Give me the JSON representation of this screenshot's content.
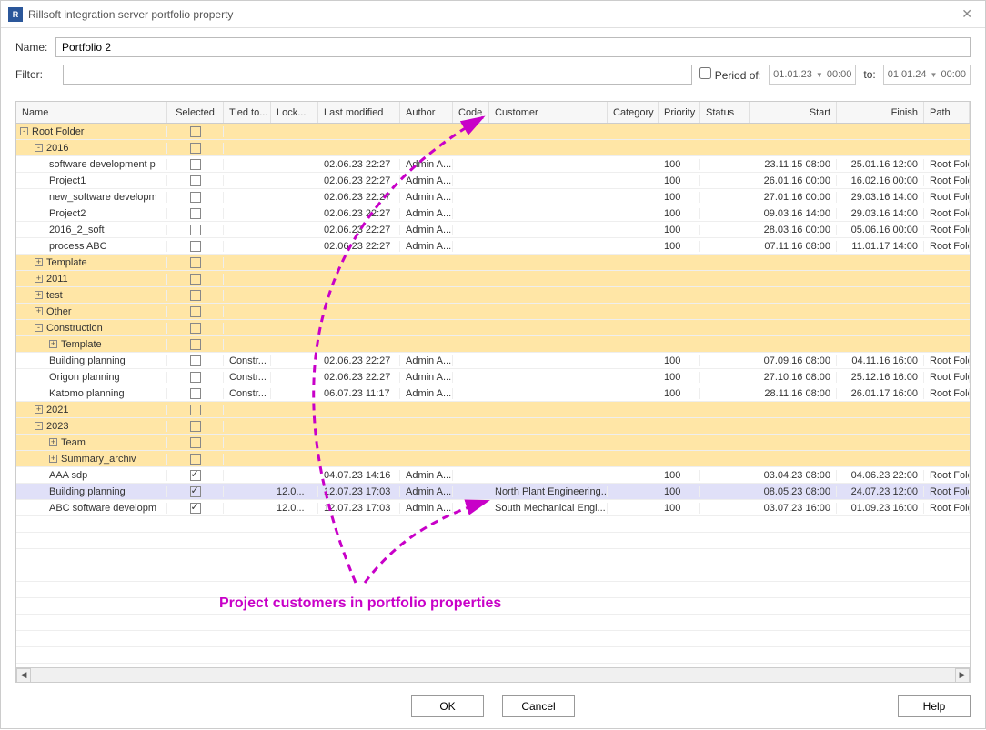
{
  "window": {
    "title": "Rillsoft integration server portfolio property",
    "icon": "R"
  },
  "form": {
    "name_label": "Name:",
    "name_value": "Portfolio 2",
    "filter_label": "Filter:",
    "period_label": "Period of:",
    "from_date": "01.01.23",
    "from_time": "00:00",
    "to_label": "to:",
    "to_date": "01.01.24",
    "to_time": "00:00"
  },
  "columns": {
    "name": "Name",
    "selected": "Selected",
    "tied": "Tied to...",
    "lock": "Lock...",
    "modified": "Last modified",
    "author": "Author",
    "code": "Code",
    "customer": "Customer",
    "category": "Category",
    "priority": "Priority",
    "status": "Status",
    "start": "Start",
    "finish": "Finish",
    "path": "Path"
  },
  "rows": [
    {
      "type": "folder",
      "depth": 0,
      "exp": "-",
      "name": "Root Folder",
      "sel": false
    },
    {
      "type": "folder",
      "depth": 1,
      "exp": "-",
      "name": "2016",
      "sel": false
    },
    {
      "type": "item",
      "depth": 2,
      "name": "software development p",
      "sel": false,
      "mod": "02.06.23 22:27",
      "auth": "Admin A...",
      "prio": "100",
      "start": "23.11.15 08:00",
      "fin": "25.01.16 12:00",
      "path": "Root Fold"
    },
    {
      "type": "item",
      "depth": 2,
      "name": "Project1",
      "sel": false,
      "mod": "02.06.23 22:27",
      "auth": "Admin A...",
      "prio": "100",
      "start": "26.01.16 00:00",
      "fin": "16.02.16 00:00",
      "path": "Root Fold"
    },
    {
      "type": "item",
      "depth": 2,
      "name": "new_software developm",
      "sel": false,
      "mod": "02.06.23 22:27",
      "auth": "Admin A...",
      "prio": "100",
      "start": "27.01.16 00:00",
      "fin": "29.03.16 14:00",
      "path": "Root Fold"
    },
    {
      "type": "item",
      "depth": 2,
      "name": "Project2",
      "sel": false,
      "mod": "02.06.23 22:27",
      "auth": "Admin A...",
      "prio": "100",
      "start": "09.03.16 14:00",
      "fin": "29.03.16 14:00",
      "path": "Root Fold"
    },
    {
      "type": "item",
      "depth": 2,
      "name": "2016_2_soft",
      "sel": false,
      "mod": "02.06.23 22:27",
      "auth": "Admin A...",
      "prio": "100",
      "start": "28.03.16 00:00",
      "fin": "05.06.16 00:00",
      "path": "Root Fold"
    },
    {
      "type": "item",
      "depth": 2,
      "name": "process ABC",
      "sel": false,
      "mod": "02.06.23 22:27",
      "auth": "Admin A...",
      "prio": "100",
      "start": "07.11.16 08:00",
      "fin": "11.01.17 14:00",
      "path": "Root Fold"
    },
    {
      "type": "folder",
      "depth": 1,
      "exp": "+",
      "name": "Template",
      "sel": false
    },
    {
      "type": "folder",
      "depth": 1,
      "exp": "+",
      "name": "2011",
      "sel": false
    },
    {
      "type": "folder",
      "depth": 1,
      "exp": "+",
      "name": "test",
      "sel": false
    },
    {
      "type": "folder",
      "depth": 1,
      "exp": "+",
      "name": "Other",
      "sel": false
    },
    {
      "type": "folder",
      "depth": 1,
      "exp": "-",
      "name": "Construction",
      "sel": false
    },
    {
      "type": "folder",
      "depth": 2,
      "exp": "+",
      "name": "Template",
      "sel": false
    },
    {
      "type": "item",
      "depth": 2,
      "name": "Building planning",
      "sel": false,
      "tied": "Constr...",
      "mod": "02.06.23 22:27",
      "auth": "Admin A...",
      "prio": "100",
      "start": "07.09.16 08:00",
      "fin": "04.11.16 16:00",
      "path": "Root Fold"
    },
    {
      "type": "item",
      "depth": 2,
      "name": "Origon planning",
      "sel": false,
      "tied": "Constr...",
      "mod": "02.06.23 22:27",
      "auth": "Admin A...",
      "prio": "100",
      "start": "27.10.16 08:00",
      "fin": "25.12.16 16:00",
      "path": "Root Fold"
    },
    {
      "type": "item",
      "depth": 2,
      "name": "Katomo planning",
      "sel": false,
      "tied": "Constr...",
      "mod": "06.07.23 11:17",
      "auth": "Admin A...",
      "prio": "100",
      "start": "28.11.16 08:00",
      "fin": "26.01.17 16:00",
      "path": "Root Fold"
    },
    {
      "type": "folder",
      "depth": 1,
      "exp": "+",
      "name": "2021",
      "sel": false
    },
    {
      "type": "folder",
      "depth": 1,
      "exp": "-",
      "name": "2023",
      "sel": false
    },
    {
      "type": "folder",
      "depth": 2,
      "exp": "+",
      "name": "Team",
      "sel": false
    },
    {
      "type": "folder",
      "depth": 2,
      "exp": "+",
      "name": "Summary_archiv",
      "sel": false
    },
    {
      "type": "item",
      "depth": 2,
      "name": "AAA sdp",
      "sel": true,
      "mod": "04.07.23 14:16",
      "auth": "Admin A...",
      "prio": "100",
      "start": "03.04.23 08:00",
      "fin": "04.06.23 22:00",
      "path": "Root Fold"
    },
    {
      "type": "item",
      "depth": 2,
      "name": "Building planning",
      "sel": true,
      "lock": "12.0...",
      "mod": "12.07.23 17:03",
      "auth": "Admin A...",
      "cust": "North Plant Engineering...",
      "prio": "100",
      "start": "08.05.23 08:00",
      "fin": "24.07.23 12:00",
      "path": "Root Fold",
      "highlight": true
    },
    {
      "type": "item",
      "depth": 2,
      "name": "ABC software developm",
      "sel": true,
      "lock": "12.0...",
      "mod": "12.07.23 17:03",
      "auth": "Admin A...",
      "cust": "South Mechanical Engi...",
      "prio": "100",
      "start": "03.07.23 16:00",
      "fin": "01.09.23 16:00",
      "path": "Root Fold"
    }
  ],
  "buttons": {
    "ok": "OK",
    "cancel": "Cancel",
    "help": "Help"
  },
  "annotation": "Project customers in portfolio properties"
}
